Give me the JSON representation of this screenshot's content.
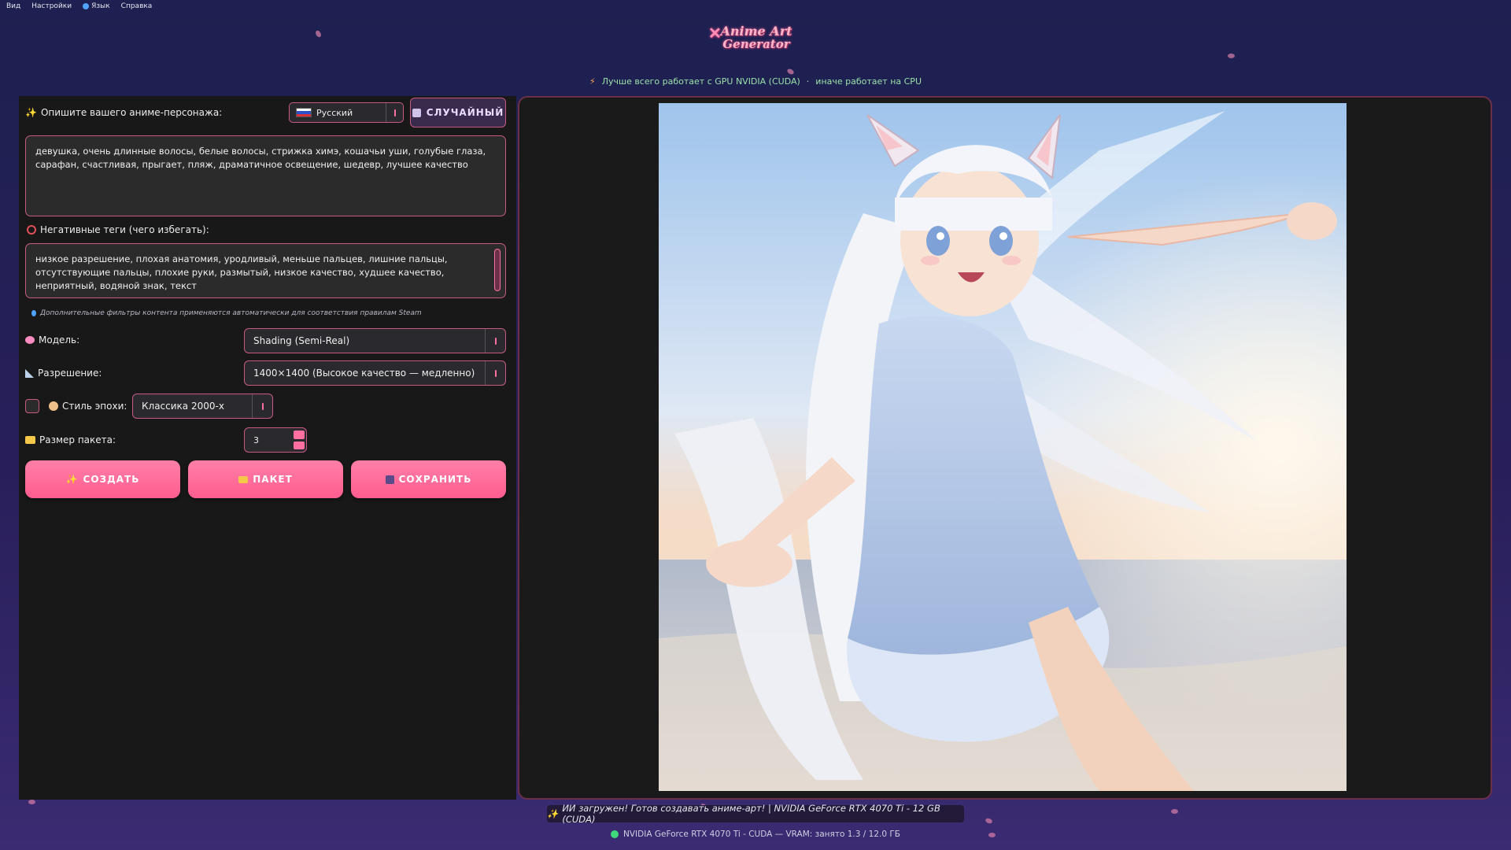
{
  "menu": {
    "view": "Вид",
    "settings": "Настройки",
    "language": "Язык",
    "help": "Справка"
  },
  "logo": {
    "line1": "Anime Art",
    "line2": "Generator"
  },
  "gpu_note": {
    "primary": "Лучше всего работает с GPU NVIDIA (CUDA)",
    "separator": "·",
    "secondary": "иначе работает на CPU"
  },
  "prompt": {
    "label": "Опишите вашего аниме-персонажа:",
    "language_value": "Русский",
    "random_label": "СЛУЧАЙНЫЙ",
    "text": "девушка, очень длинные волосы, белые волосы, стрижка химэ, кошачьи уши, голубые глаза, сарафан, счастливая, прыгает, пляж, драматичное освещение, шедевр, лучшее качество"
  },
  "negative": {
    "label": "Негативные теги (чего избегать):",
    "text": "низкое разрешение, плохая анатомия, уродливый, меньше пальцев, лишние пальцы, отсутствующие пальцы, плохие руки, размытый, низкое качество, худшее качество, неприятный, водяной знак, текст"
  },
  "hint": "Дополнительные фильтры контента применяются автоматически для соответствия правилам Steam",
  "settings": {
    "model_label": "Модель:",
    "model_value": "Shading (Semi-Real)",
    "resolution_label": "Разрешение:",
    "resolution_value": "1400×1400 (Высокое качество — медленно)",
    "era_label": "Стиль эпохи:",
    "era_value": "Классика 2000-х",
    "era_enabled": false,
    "batch_label": "Размер пакета:",
    "batch_value": "3"
  },
  "actions": {
    "create": "СОЗДАТЬ",
    "batch": "ПАКЕТ",
    "save": "СОХРАНИТЬ"
  },
  "status": "ИИ загружен! Готов создавать аниме-арт! | NVIDIA GeForce RTX 4070 Ti - 12 GB (CUDA)",
  "hardware": "NVIDIA GeForce RTX 4070 Ti - CUDA — VRAM: занято 1.3 / 12.0 ГБ",
  "colors": {
    "accent": "#ff6fa0",
    "border": "#c85a82",
    "panel": "#181818",
    "ok": "#3fd87a"
  }
}
